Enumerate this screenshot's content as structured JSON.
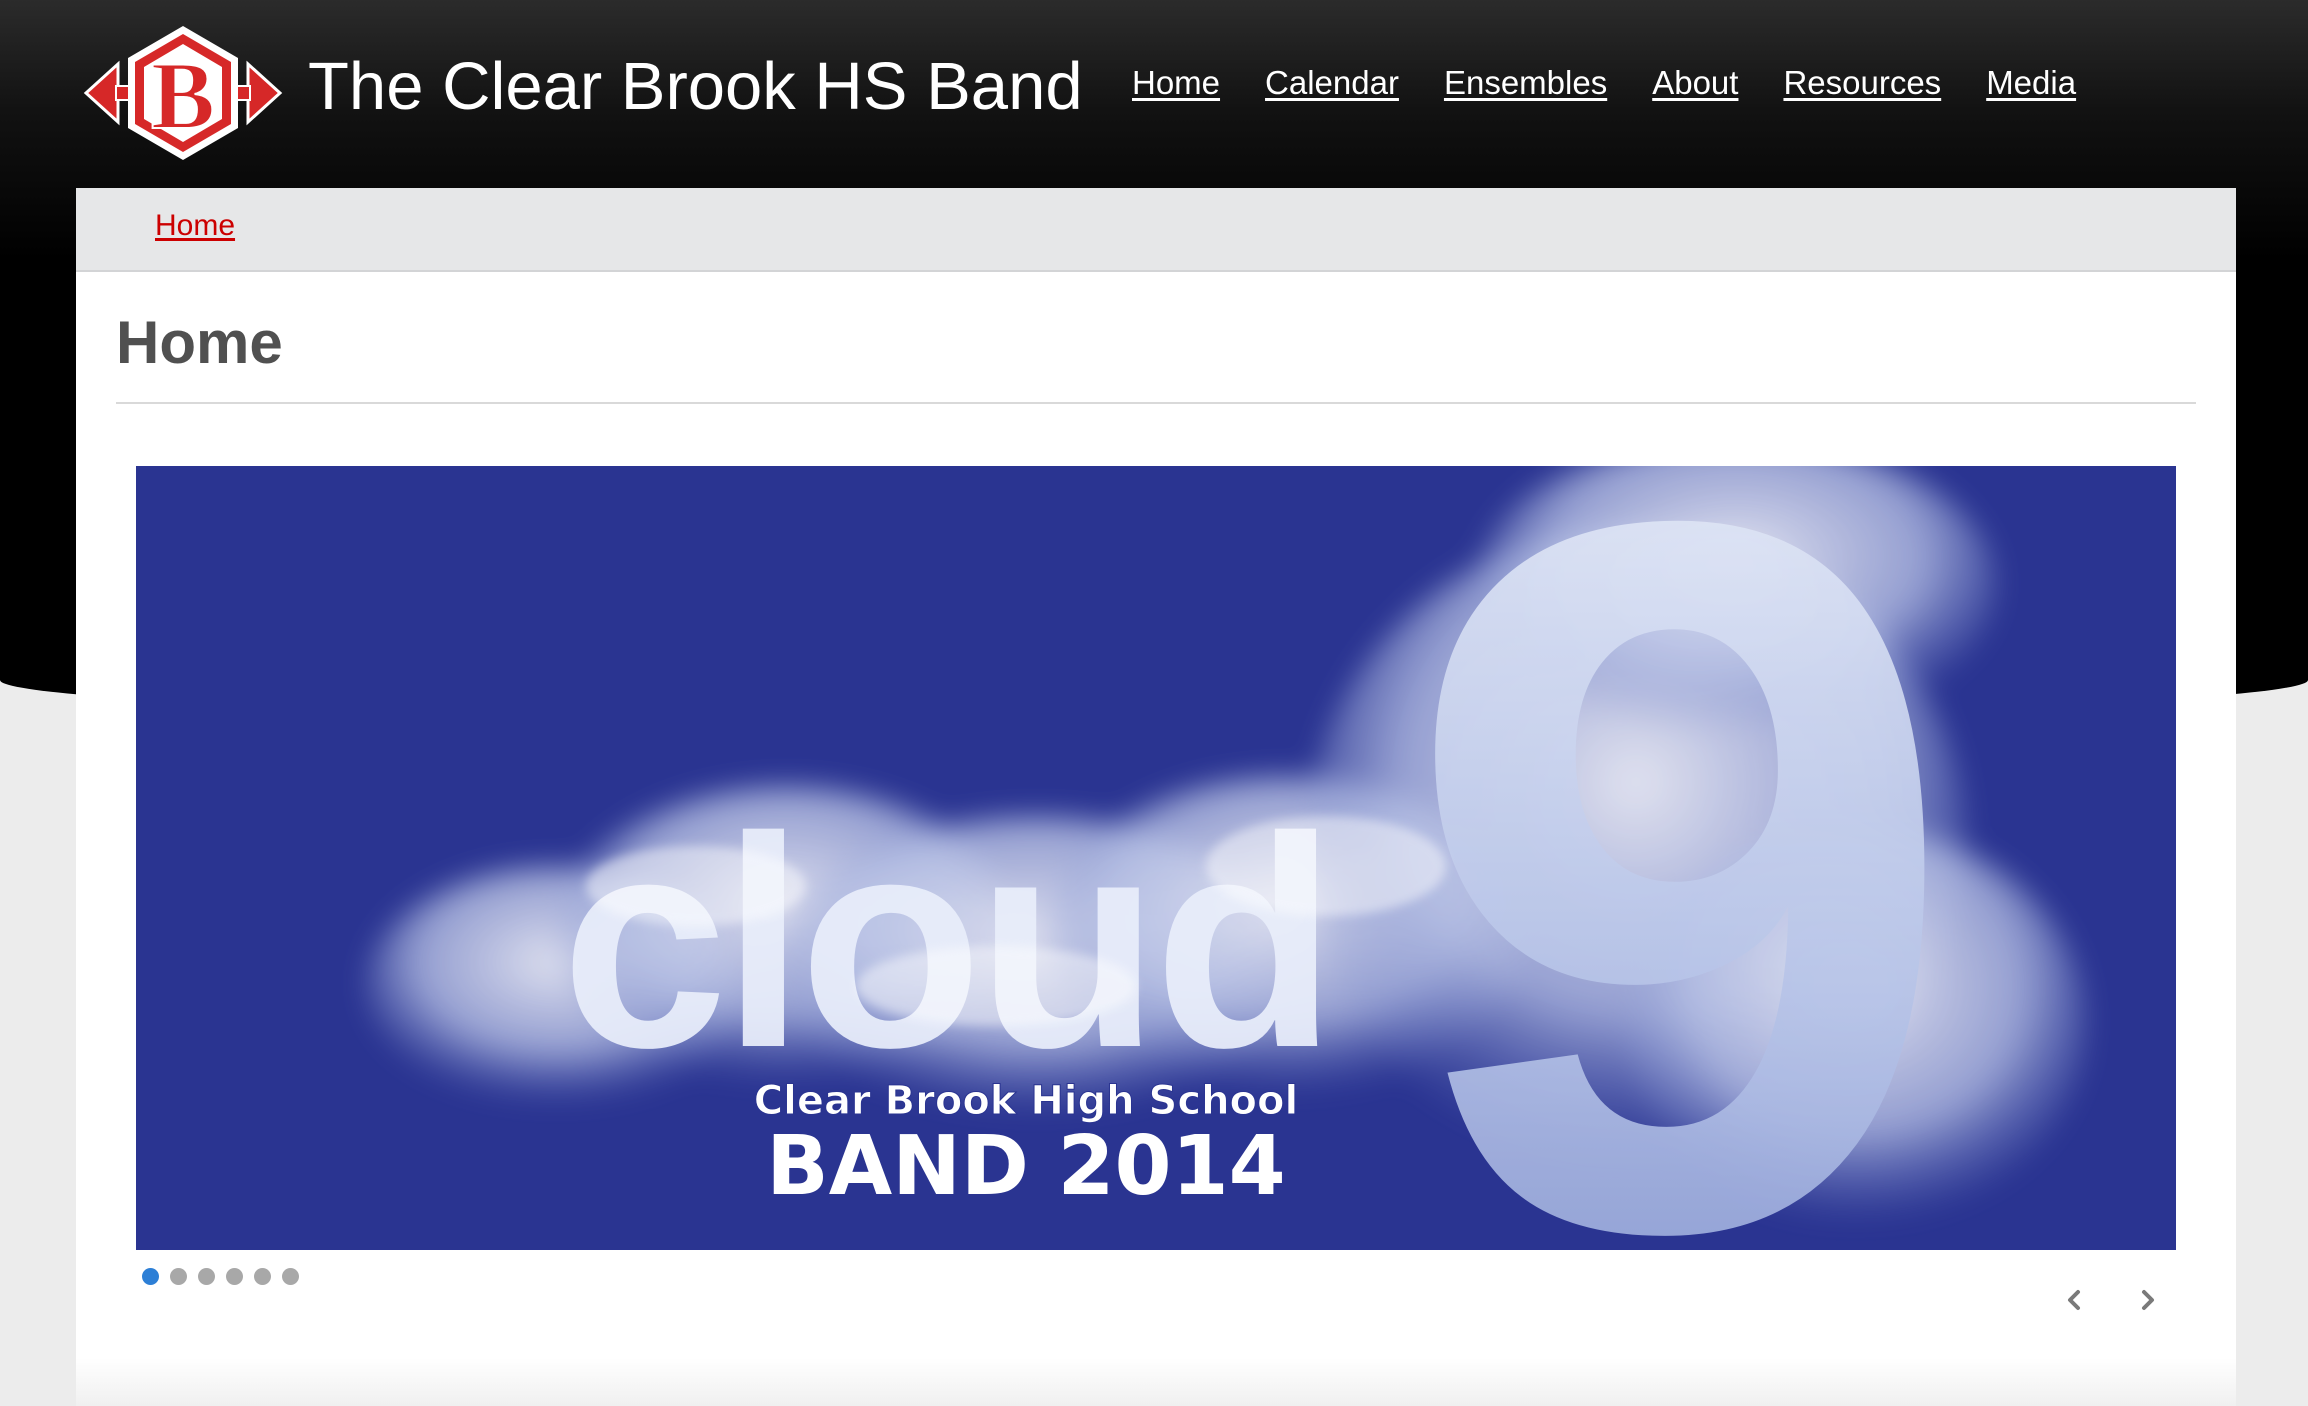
{
  "site": {
    "title": "The Clear Brook HS Band",
    "logo_letter": "B",
    "brand_color": "#d62828"
  },
  "nav": {
    "items": [
      {
        "label": "Home"
      },
      {
        "label": "Calendar"
      },
      {
        "label": "Ensembles"
      },
      {
        "label": "About"
      },
      {
        "label": "Resources"
      },
      {
        "label": "Media"
      }
    ]
  },
  "breadcrumb": {
    "home": "Home"
  },
  "page": {
    "title": "Home"
  },
  "slider": {
    "headline": "cloud",
    "numeral": "9",
    "school": "Clear Brook High School",
    "band_year": "BAND 2014",
    "background_color": "#2a3491",
    "total_slides": 6,
    "active_slide": 1
  },
  "colors": {
    "breadcrumb_link": "#cc0000",
    "active_dot": "#2d7fd6",
    "inactive_dot": "#a8a8a8"
  },
  "icons": {
    "prev": "chevron-left-icon",
    "next": "chevron-right-icon"
  }
}
